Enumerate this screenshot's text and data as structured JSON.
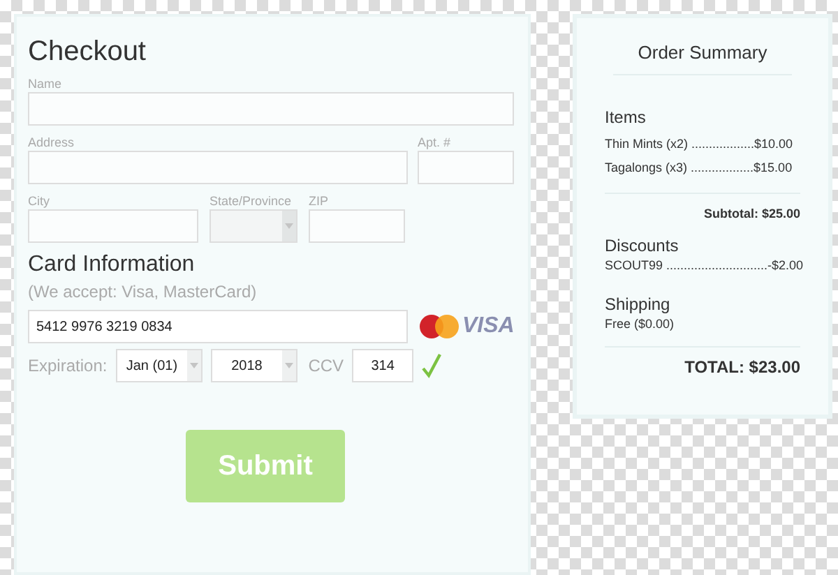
{
  "checkout": {
    "title": "Checkout",
    "fields": [
      {
        "label": "Name"
      },
      {
        "label": "Address"
      },
      {
        "label": "Apt. #"
      },
      {
        "label": "City"
      },
      {
        "label": "State/Province"
      },
      {
        "label": "ZIP"
      }
    ],
    "card": {
      "title": "Card Information",
      "note": "(We accept: Visa, MasterCard)",
      "number": "5412 9976 3219 0834",
      "brand_text": "VISA",
      "expiration_label": "Expiration:",
      "month": "Jan (01)",
      "year": "2018",
      "ccv_label": "CCV",
      "ccv": "314",
      "ccv_valid": true
    },
    "submit": "Submit"
  },
  "summary": {
    "title": "Order Summary",
    "items_title": "Items",
    "items": [
      "Thin Mints (x2) ..................$10.00",
      "Tagalongs (x3) ..................$15.00"
    ],
    "subtotal": "Subtotal: $25.00",
    "discounts_title": "Discounts",
    "discounts": [
      "SCOUT99 .............................-$2.00"
    ],
    "shipping_title": "Shipping",
    "shipping": "Free ($0.00)",
    "total": "TOTAL: $23.00"
  }
}
